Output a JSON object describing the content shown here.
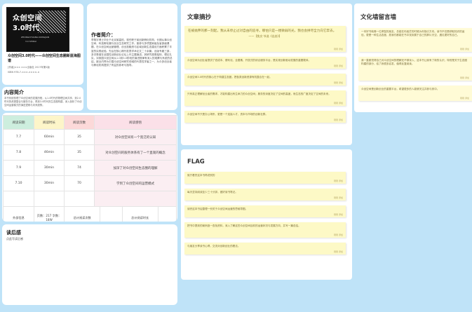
{
  "book": {
    "cover_title_1": "众创空间",
    "cover_title_2": "3.0时代",
    "cover_line_1": "ZHONGCHUANG KONGJIAN",
    "cover_line_2": "3.0 SHIDAI",
    "title": "众创空间3.0时代——众创空间生态圈新蓝海图谱",
    "meta": "[作者]×××  ×××出版社  2017年第1版",
    "meta2": "ISBN 978-7-×××-××××-×"
  },
  "author": {
    "heading": "作者简介：",
    "body": "李翔宇博士毕业于北京某高校，现任职于某创新孵化机构，长期从事众创空间、科技孵化器与创业生态研究工作。曾参与多项国家级及省部级课题，在众创空间运营管理、创业投融资与区域创新生态建设方面积累了丰富的实践经验。先后在核心期刊发表学术论文二十余篇，出版专著三部，多次受邀在全国性创新创业论坛上作主题演讲。其研究视角独特、理论扎实，对我国众创空间从1.0到3.0阶段的演进规律有深入的观察与系统的总结，被业内誉为中国众创空间研究领域的代表性学者之一，为众多创业者与孵化机构提供了有益的参考与指导。"
  },
  "intro": {
    "heading": "内容简介",
    "body": "本书系统梳理了众创空间的发展历程，从1.0时代的物理空间共享，到2.0时代的资源整合与服务平台，再到3.0时代的生态圈构建，深入剖析了众创空间运营模式的演进逻辑与未来趋势。"
  },
  "reading_log": {
    "headers": [
      "阅读日期",
      "阅读时长",
      "阅读页数",
      "阅读感悟"
    ],
    "rows": [
      {
        "date": "7.7",
        "duration": "60min",
        "pages": "35",
        "note": "对众创空间有一个宽泛的认知"
      },
      {
        "date": "7.8",
        "duration": "46min",
        "pages": "35",
        "note": "对众创空间的服务体系有了一个直观的概念"
      },
      {
        "date": "7.9",
        "duration": "30min",
        "pages": "74",
        "note": "加深了对众创空间生态圈的理解"
      },
      {
        "date": "7.10",
        "duration": "30min",
        "pages": "70",
        "note": "学到了众创空间的运营模式"
      },
      {
        "date": "",
        "duration": "",
        "pages": "",
        "note": ""
      }
    ],
    "footer": {
      "label": "外部信息",
      "stats": "页数：217  字数：18W",
      "total_label": "总计阅读次数",
      "total_value": "",
      "time_label": "总计阅读时长",
      "time_value": ""
    }
  },
  "reflection": {
    "heading": "读后感",
    "body": "点此写读后感"
  },
  "excerpt": {
    "heading": "文章摘抄",
    "notes": [
      {
        "text": "在被抛弃的那一刻起，我从未停止过对自由的追寻。哪怕只是一缕微弱的光，我也会拼尽全力向它奔去。",
        "source": "——【佚文·节选《出处》】",
        "time": "刚刚 添加",
        "big": true
      },
      {
        "text": "众创空间为创业者提供了低成本、便利化、全要素、开放式的综合服务平台，是实现创新驱动发展的重要载体。",
        "time": "刚刚 添加"
      },
      {
        "text": "众创空间3.0时代的核心在于构建生态圈，把各类创新资源有机整合在一起。",
        "time": "刚刚 添加"
      },
      {
        "text": "只有真正理解创业者的需求，才能构建出有生命力的众创空间；服务的深度决定了空间的高度，而生态的广度决定了空间的未来。",
        "time": "刚刚 添加"
      },
      {
        "text": "众创空间不只是办公场所，更是一个连接人才、资本与市场的创新社群。",
        "time": "刚刚 添加"
      }
    ]
  },
  "flag": {
    "heading": "FLAG",
    "notes": [
      {
        "text": "就只看完这本书再说别的",
        "time": "刚刚 添加"
      },
      {
        "text": "每天坚持阅读至少三十分钟，做好读书笔记。",
        "time": "刚刚 添加"
      },
      {
        "text": "读完这本书后整理一份关于众创空间运营的思维导图。",
        "time": "刚刚 添加"
      },
      {
        "text": "把书中提到的案例逐一查找资料，深入了解这些众创空间目前的运营状况与发展方向，并写一篇总结。",
        "time": "刚刚 添加"
      },
      {
        "text": "与朋友分享读书心得，交流对创新创业的看法。",
        "time": "刚刚 添加"
      }
    ]
  },
  "wall": {
    "heading": "文化墙留言墙",
    "notes": [
      {
        "text": "一本好书就像一位睿智的朋友，总能在你迷茫的时候为你指引方向。读书不仅是获取知识的途径，更是一种生活态度，愿我们都能在书中找到属于自己的那片天空，遇见更好的自己。",
        "time": "刚刚 添加"
      },
      {
        "text": "我一直都觉得自己对众创空间的理解还不够深入，这本书让我有了新的认识，特别是关于生态圈构建的部分，给了我很多启发，值得反复阅读。",
        "time": "刚刚 添加"
      },
      {
        "text": "众创空间是创新创业的重要平台，希望更多的人能够关注并参与其中。",
        "time": "刚刚 添加"
      }
    ]
  },
  "colors": {
    "background": "#bfe3f8",
    "note_yellow": "#fdf9c6",
    "header_green": "#cdeede",
    "header_yellow": "#fdf5c9",
    "header_pink": "#fcd9d9"
  }
}
